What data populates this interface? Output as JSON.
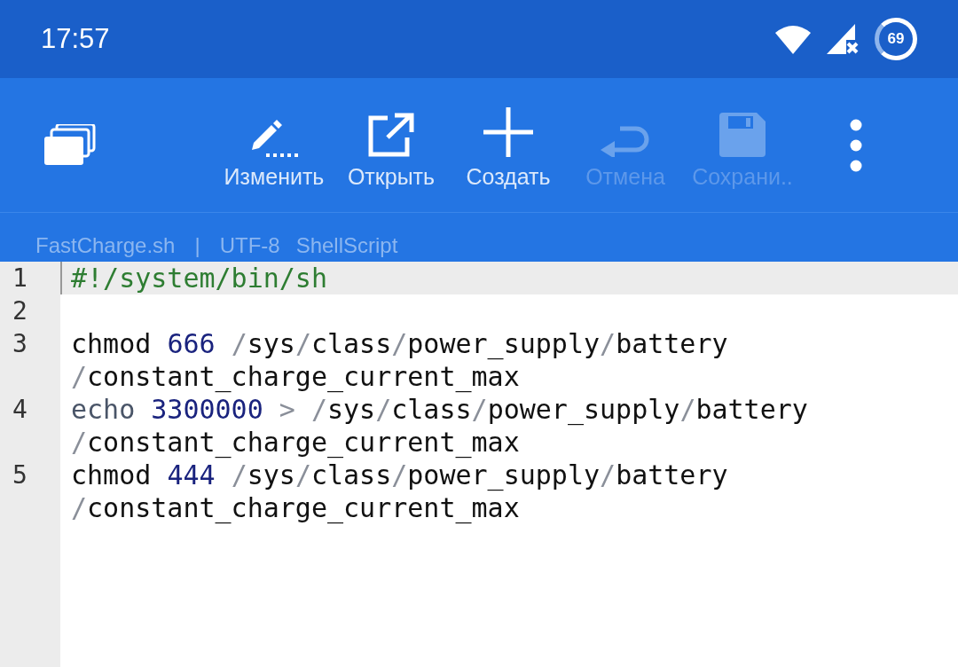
{
  "status_bar": {
    "time": "17:57",
    "battery": "69"
  },
  "toolbar": {
    "actions": [
      {
        "kind": "edit",
        "label": "Изменить",
        "disabled": false
      },
      {
        "kind": "open",
        "label": "Открыть",
        "disabled": false
      },
      {
        "kind": "new",
        "label": "Создать",
        "disabled": false
      },
      {
        "kind": "undo",
        "label": "Отмена",
        "disabled": true
      },
      {
        "kind": "save",
        "label": "Сохрани..",
        "disabled": true
      }
    ]
  },
  "file_info": {
    "name": "FastCharge.sh",
    "separator": "|",
    "encoding": "UTF-8",
    "syntax": "ShellScript"
  },
  "editor": {
    "lines": [
      {
        "number": "1",
        "selected": true,
        "rows": [
          [
            {
              "kind": "comment",
              "text": "#!/system/bin/sh"
            }
          ]
        ]
      },
      {
        "number": "2",
        "selected": false
      },
      {
        "number": "3",
        "selected": false,
        "rows": [
          [
            {
              "kind": "cmd",
              "text": "chmod "
            },
            {
              "kind": "num",
              "text": "666"
            },
            {
              "kind": "cmd",
              "text": " "
            },
            {
              "kind": "op",
              "text": "/"
            },
            {
              "kind": "cmd",
              "text": "sys"
            },
            {
              "kind": "op",
              "text": "/"
            },
            {
              "kind": "cmd",
              "text": "class"
            },
            {
              "kind": "op",
              "text": "/"
            },
            {
              "kind": "cmd",
              "text": "power_supply"
            },
            {
              "kind": "op",
              "text": "/"
            },
            {
              "kind": "cmd",
              "text": "battery"
            }
          ],
          [
            {
              "kind": "op",
              "text": "/"
            },
            {
              "kind": "cmd",
              "text": "constant_charge_current_max"
            }
          ]
        ]
      },
      {
        "number": "4",
        "selected": false,
        "rows": [
          [
            {
              "kind": "builtin",
              "text": "echo "
            },
            {
              "kind": "num",
              "text": "3300000"
            },
            {
              "kind": "cmd",
              "text": " "
            },
            {
              "kind": "op",
              "text": ">"
            },
            {
              "kind": "cmd",
              "text": " "
            },
            {
              "kind": "op",
              "text": "/"
            },
            {
              "kind": "cmd",
              "text": "sys"
            },
            {
              "kind": "op",
              "text": "/"
            },
            {
              "kind": "cmd",
              "text": "class"
            },
            {
              "kind": "op",
              "text": "/"
            },
            {
              "kind": "cmd",
              "text": "power_supply"
            },
            {
              "kind": "op",
              "text": "/"
            },
            {
              "kind": "cmd",
              "text": "battery"
            }
          ],
          [
            {
              "kind": "op",
              "text": "/"
            },
            {
              "kind": "cmd",
              "text": "constant_charge_current_max"
            }
          ]
        ]
      },
      {
        "number": "5",
        "selected": false,
        "rows": [
          [
            {
              "kind": "cmd",
              "text": "chmod "
            },
            {
              "kind": "num",
              "text": "444"
            },
            {
              "kind": "cmd",
              "text": " "
            },
            {
              "kind": "op",
              "text": "/"
            },
            {
              "kind": "cmd",
              "text": "sys"
            },
            {
              "kind": "op",
              "text": "/"
            },
            {
              "kind": "cmd",
              "text": "class"
            },
            {
              "kind": "op",
              "text": "/"
            },
            {
              "kind": "cmd",
              "text": "power_supply"
            },
            {
              "kind": "op",
              "text": "/"
            },
            {
              "kind": "cmd",
              "text": "battery"
            }
          ],
          [
            {
              "kind": "op",
              "text": "/"
            },
            {
              "kind": "cmd",
              "text": "constant_charge_current_max"
            }
          ]
        ]
      }
    ]
  }
}
